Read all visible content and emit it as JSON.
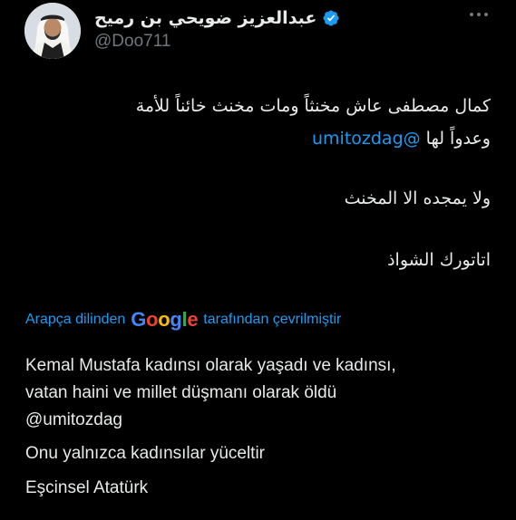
{
  "author": {
    "display_name": "عبدالعزيز ضويحي بن رميح",
    "handle": "@Doo711",
    "avatar_icon": "user-avatar",
    "verified_icon": "verified-badge-icon"
  },
  "tweet": {
    "arabic_line1": "كمال مصطفى عاش مخنثاً ومات مخنث خائناً للأمة",
    "arabic_line2_text": "وعدواً لها",
    "arabic_line2_mention": "@umitozdag",
    "arabic_line3": "ولا يمجده الا المخنث",
    "arabic_line4": "اتاتورك الشواذ"
  },
  "translation": {
    "prefix": "Arapça dilinden",
    "provider": "Google",
    "suffix": "tarafından çevrilmiştir",
    "line1": "Kemal Mustafa kadınsı olarak yaşadı ve kadınsı,",
    "line2": "vatan haini ve millet düşmanı olarak öldü",
    "mention": "@umitozdag",
    "line4": "Onu yalnızca kadınsılar yüceltir",
    "line5": "Eşcinsel Atatürk"
  },
  "colors": {
    "background": "#000000",
    "text": "#e7e9ea",
    "secondary": "#71767b",
    "link": "#1d9bf0",
    "verified": "#1d9bf0"
  },
  "google_letters": [
    {
      "ch": "G",
      "color": "#4285F4"
    },
    {
      "ch": "o",
      "color": "#EA4335"
    },
    {
      "ch": "o",
      "color": "#FBBC05"
    },
    {
      "ch": "g",
      "color": "#4285F4"
    },
    {
      "ch": "l",
      "color": "#34A853"
    },
    {
      "ch": "e",
      "color": "#EA4335"
    }
  ]
}
